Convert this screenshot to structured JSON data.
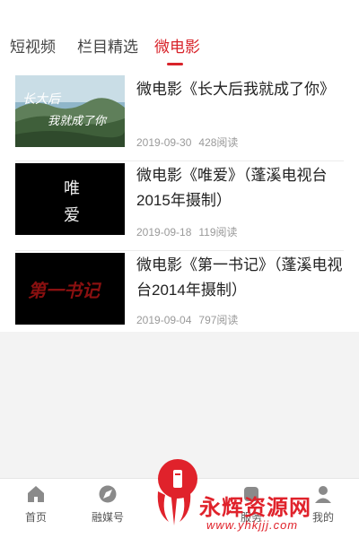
{
  "tabs": [
    {
      "label": "短视频"
    },
    {
      "label": "栏目精选"
    },
    {
      "label": "微电影"
    }
  ],
  "active_tab": "微电影",
  "colors": {
    "accent": "#d8232a",
    "meta": "#9a9a9a",
    "text": "#222222"
  },
  "videos": [
    {
      "title": "微电影《长大后我就成了你》",
      "date": "2019-09-30",
      "reads": "428阅读",
      "thumb_text": [
        "长大后",
        "我就成了你"
      ]
    },
    {
      "title": "微电影《唯爱》（蓬溪电视台2015年摄制）",
      "date": "2019-09-18",
      "reads": "119阅读",
      "thumb_text": [
        "唯",
        "爱"
      ]
    },
    {
      "title": "微电影《第一书记》（蓬溪电视台2014年摄制）",
      "date": "2019-09-04",
      "reads": "797阅读",
      "thumb_text": [
        "第一书记"
      ]
    }
  ],
  "tabbar": [
    {
      "label": "首页",
      "icon": "home-icon"
    },
    {
      "label": "融媒号",
      "icon": "compass-icon"
    },
    {
      "label": "",
      "icon": "center-plus-icon"
    },
    {
      "label": "服务",
      "icon": "service-icon"
    },
    {
      "label": "我的",
      "icon": "user-icon"
    }
  ],
  "watermark": {
    "text": "永辉资源网",
    "url": "www.yhkjjj.com"
  }
}
